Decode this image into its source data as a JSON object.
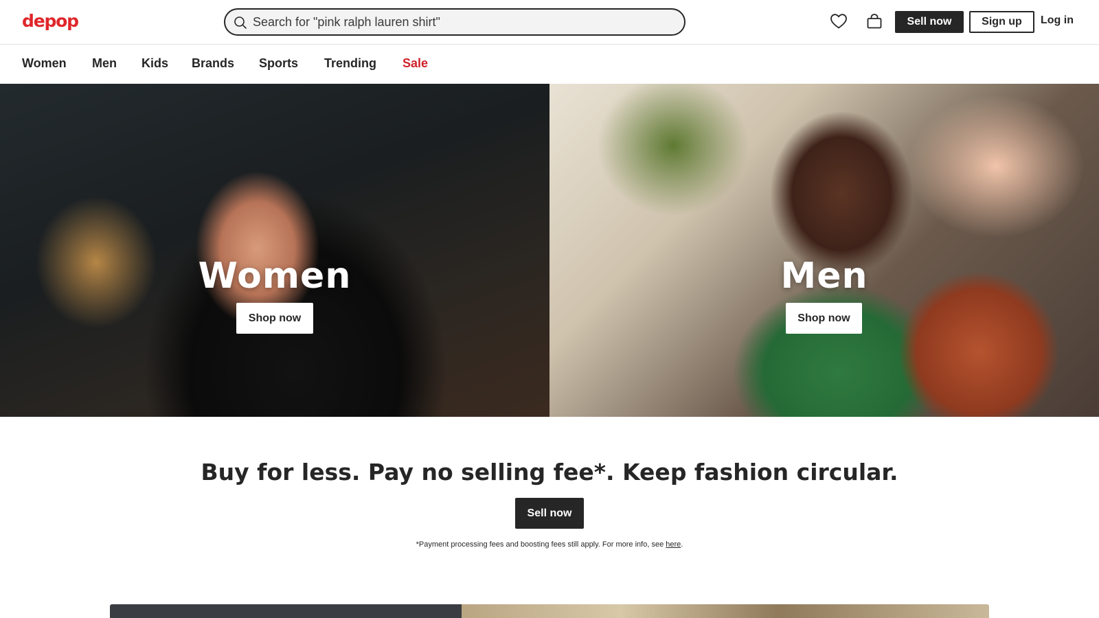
{
  "header": {
    "logo": "depop",
    "search_placeholder": "Search for \"pink ralph lauren shirt\"",
    "icons": {
      "search": "search-icon",
      "likes": "heart-icon",
      "bag": "shopping-bag-icon"
    },
    "sell_label": "Sell now",
    "signup_label": "Sign up",
    "login_label": "Log in"
  },
  "nav": {
    "items": [
      {
        "label": "Women"
      },
      {
        "label": "Men"
      },
      {
        "label": "Kids"
      },
      {
        "label": "Brands"
      },
      {
        "label": "Sports"
      },
      {
        "label": "Trending"
      },
      {
        "label": "Sale"
      }
    ]
  },
  "hero": {
    "women": {
      "title": "Women",
      "button": "Shop now"
    },
    "men": {
      "title": "Men",
      "button": "Shop now"
    }
  },
  "promo": {
    "title": "Buy for less. Pay no selling fee*. Keep fashion circular.",
    "button": "Sell now",
    "footnote_text": "*Payment processing fees and boosting fees still apply. For more info, see ",
    "footnote_link": "here",
    "footnote_end": "."
  },
  "colors": {
    "brand": "#e0262b",
    "sale": "#d0212b",
    "dark": "#262626",
    "border": "#e2e2e2"
  }
}
